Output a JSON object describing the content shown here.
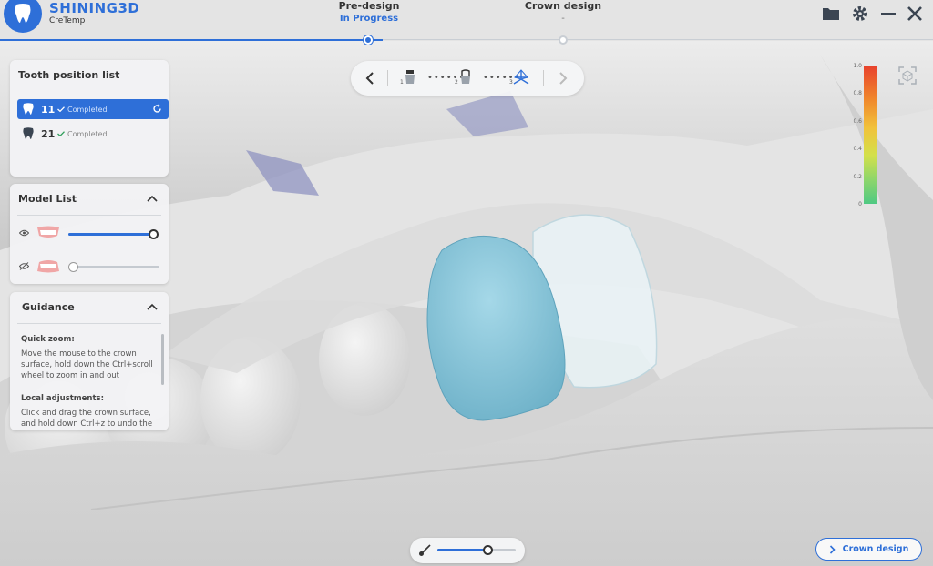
{
  "app": {
    "brand": "SHINING3D",
    "subbrand": "CreTemp"
  },
  "steps": [
    {
      "title": "Pre-design",
      "status": "In Progress"
    },
    {
      "title": "Crown design",
      "status": "-"
    }
  ],
  "tooth_panel": {
    "title": "Tooth position list",
    "items": [
      {
        "number": "11",
        "status": "Completed"
      },
      {
        "number": "21",
        "status": "Completed"
      }
    ]
  },
  "model_panel": {
    "title": "Model List",
    "models": [
      {
        "name": "upper-jaw",
        "visible": true,
        "opacity": 1.0
      },
      {
        "name": "lower-jaw",
        "visible": false,
        "opacity": 0.0
      }
    ]
  },
  "guidance": {
    "title": "Guidance",
    "sections": [
      {
        "heading": "Quick zoom:",
        "body": "Move the mouse to the crown surface, hold down the Ctrl+scroll wheel to zoom in and out"
      },
      {
        "heading": "Local adjustments:",
        "body": "Click and drag the crown surface, and hold down Ctrl+z to undo the"
      }
    ]
  },
  "toolbar": {
    "steps": [
      "1",
      "2",
      "3"
    ]
  },
  "color_scale": {
    "labels": [
      "1.0",
      "0.8",
      "0.6",
      "0.4",
      "0.2",
      "0"
    ]
  },
  "brush_slider": {
    "value": 0.65
  },
  "crown_design_button": {
    "label": "Crown design"
  },
  "colors": {
    "accent": "#2e6fd8",
    "crown": "#86c6dc",
    "scan": "#e3e3e3"
  }
}
